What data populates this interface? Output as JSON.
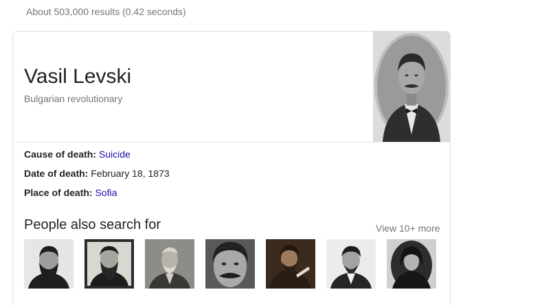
{
  "search": {
    "result_stats": "About 503,000 results (0.42 seconds)"
  },
  "knowledge_panel": {
    "title": "Vasil Levski",
    "subtitle": "Bulgarian revolutionary",
    "image_alt": "portrait-photo",
    "facts": [
      {
        "label": "Cause of death:",
        "value": "Suicide",
        "is_link": true
      },
      {
        "label": "Date of death:",
        "value": "February 18, 1873",
        "is_link": false
      },
      {
        "label": "Place of death:",
        "value": "Sofia",
        "is_link": true
      }
    ],
    "people_also_search": {
      "heading": "People also search for",
      "more_label": "View 10+ more",
      "thumbnail_count": 7
    }
  },
  "colors": {
    "link": "#1a0dab",
    "secondary_text": "#70757a",
    "primary_text": "#202124",
    "border": "#dfe1e5"
  }
}
